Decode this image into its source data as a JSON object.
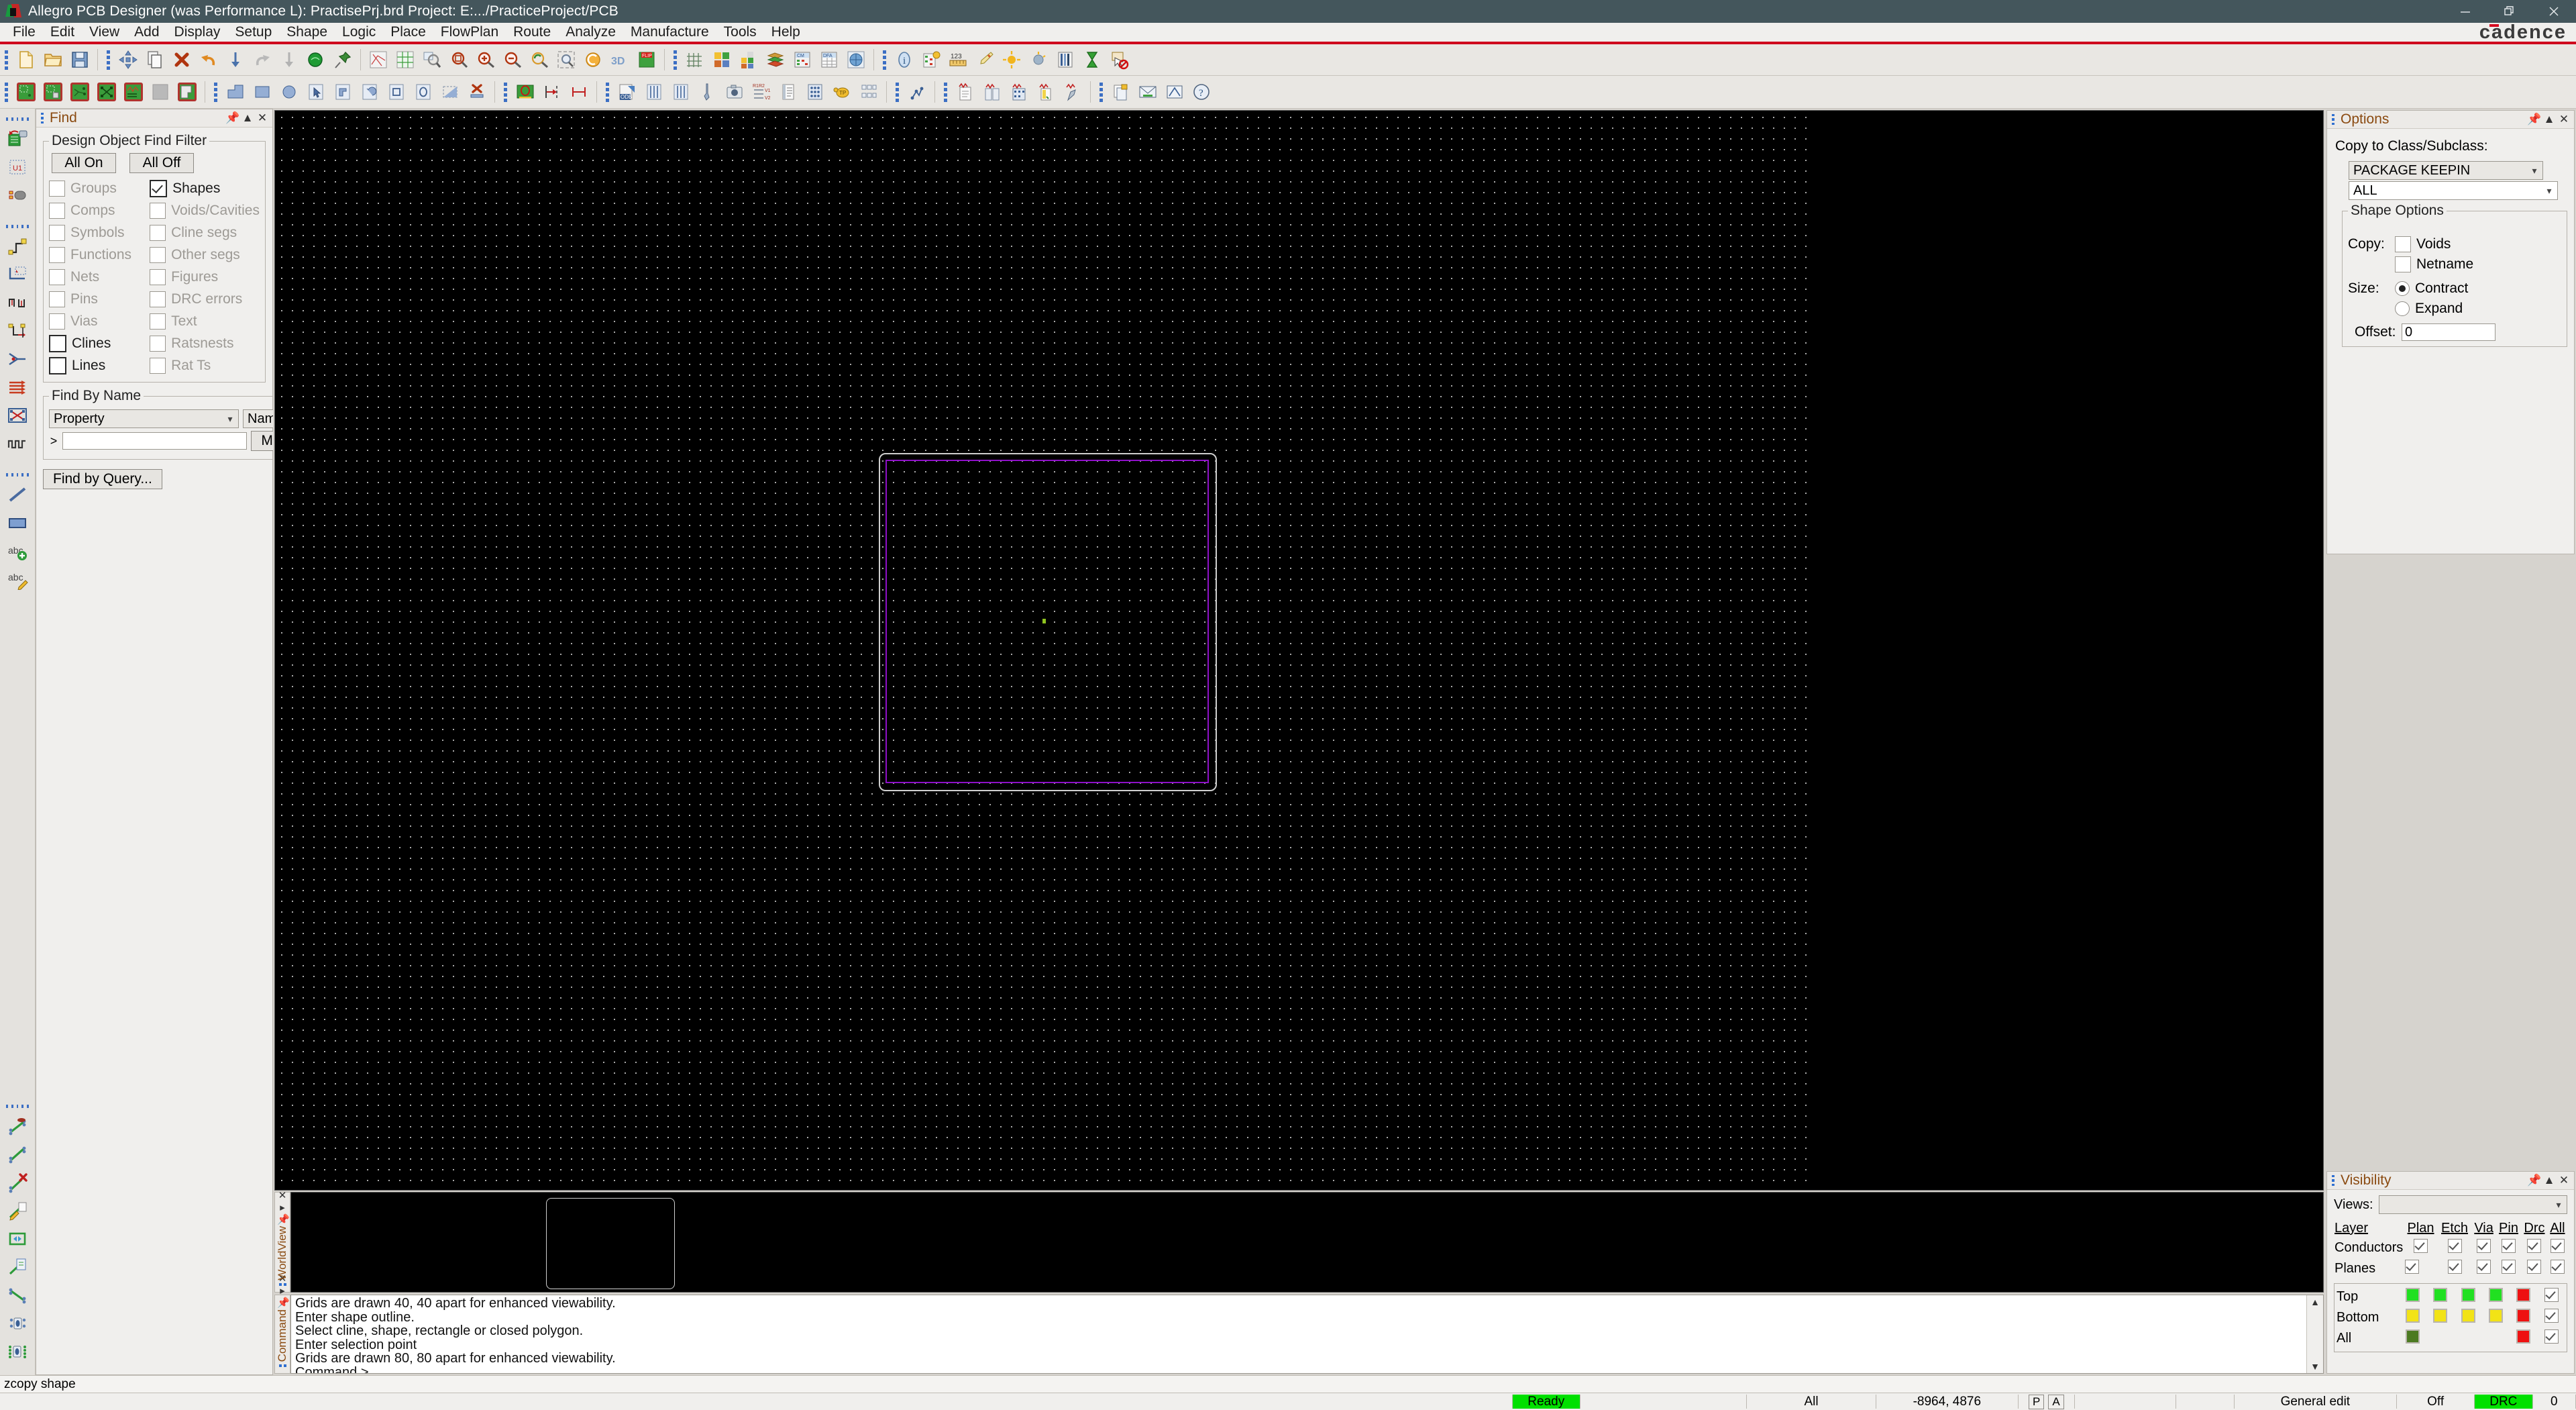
{
  "window": {
    "title": "Allegro PCB Designer (was Performance L): PractisePrj.brd  Project: E:.../PracticeProject/PCB",
    "app_icon": "allegro-icon",
    "minimize": "—",
    "restore": "restore-icon",
    "close": "✕",
    "brand": "cadence"
  },
  "menubar": {
    "items": [
      {
        "label": "File",
        "mnemonic": "F"
      },
      {
        "label": "Edit",
        "mnemonic": "E"
      },
      {
        "label": "View",
        "mnemonic": "V"
      },
      {
        "label": "Add",
        "mnemonic": "A"
      },
      {
        "label": "Display",
        "mnemonic": "D"
      },
      {
        "label": "Setup",
        "mnemonic": "u"
      },
      {
        "label": "Shape",
        "mnemonic": "S"
      },
      {
        "label": "Logic",
        "mnemonic": "L"
      },
      {
        "label": "Place",
        "mnemonic": "P"
      },
      {
        "label": "FlowPlan",
        "mnemonic": "n"
      },
      {
        "label": "Route",
        "mnemonic": "R"
      },
      {
        "label": "Analyze",
        "mnemonic": "z"
      },
      {
        "label": "Manufacture",
        "mnemonic": "M"
      },
      {
        "label": "Tools",
        "mnemonic": "T"
      },
      {
        "label": "Help",
        "mnemonic": "H"
      }
    ]
  },
  "toolbar_row1": {
    "icons": [
      "new-file-icon",
      "open-folder-icon",
      "save-icon",
      "move-icon",
      "copy-icon",
      "delete-icon",
      "undo-icon",
      "down-arrow-icon",
      "redo-icon",
      "down-arrow-grey-icon",
      "globe-green-icon",
      "pin-icon",
      "ratsnest-icon",
      "grid-net-icon",
      "zoom-fit-icon",
      "zoom-region-icon",
      "zoom-in-icon",
      "zoom-out-icon",
      "zoom-previous-icon",
      "zoom-selection-icon",
      "refresh-icon",
      "3d-view-icon",
      "flip-design-icon",
      "grid-toggle-icon",
      "color-palette-icon",
      "color-layers-icon",
      "layer-stackup-icon",
      "constraint-manager-icon",
      "dfa-table-icon",
      "globe-grid-icon",
      "info-icon",
      "property-edit-icon",
      "measure-icon",
      "highlight-icon",
      "sun-light-icon",
      "dim-icon",
      "layer-bars-icon",
      "hourglass-icon",
      "cursor-block-icon"
    ]
  },
  "toolbar_row2": {
    "icons": [
      "place-manual-icon",
      "place-quickplace-icon",
      "place-swap-icon",
      "place-autoplace-icon",
      "place-replicate-icon",
      "blank-shape-icon",
      "copy-shape-icon",
      "shape-polygon-icon",
      "shape-rect-icon",
      "shape-circle-icon",
      "shape-oval-icon",
      "shape-select-icon",
      "shape-rect2-icon",
      "shape-arc-icon",
      "shape-square-icon",
      "shape-ellipse-icon",
      "shape-void-icon",
      "shape-delete-icon",
      "board-geometry-icon",
      "dimension-line-icon",
      "dimension-measure-icon",
      "odb-export-icon",
      "drill-legend-icon",
      "nc-drill-icon",
      "drill-tool-icon",
      "camera-icon",
      "r1r2-rename-icon",
      "report-icon",
      "padstack-grid-icon",
      "testprep-icon",
      "bom-icon",
      "signal-probe-icon",
      "si-report-icon",
      "si-library-icon",
      "si-model-icon",
      "si-assign-icon",
      "si-sim-icon",
      "doc-export-icon",
      "mail-icon",
      "net-schedule-icon",
      "help-circle-icon"
    ]
  },
  "left_toolbar": {
    "groups": [
      {
        "icons": [
          "netlist-import-icon",
          "device-u1-icon",
          "pin-assign-icon"
        ]
      },
      {
        "icons": [
          "add-connect-icon",
          "route-area-icon",
          "phase-tune-icon",
          "delay-tune-icon",
          "fanout-icon",
          "bus-route-icon",
          "auto-route-icon",
          "meander-icon"
        ]
      },
      {
        "icons": [
          "line-icon",
          "rect-filled-icon",
          "add-text-icon",
          "edit-text-icon"
        ]
      }
    ],
    "bottom_group": {
      "icons": [
        "net-top-icon",
        "net-line-icon",
        "net-delete-icon",
        "net-edit-icon",
        "net-spread-icon",
        "net-copy-icon",
        "net-thin-icon",
        "net-via-icon",
        "net-multi-via-icon"
      ]
    }
  },
  "find_panel": {
    "title": "Find",
    "pin_icon": "pin-icon",
    "collapse_icon": "chevron-up-icon",
    "close_icon": "close-icon",
    "filter_group_label": "Design Object Find Filter",
    "all_on": "All On",
    "all_off": "All Off",
    "left_column": [
      {
        "label": "Groups",
        "checked": false,
        "enabled": false
      },
      {
        "label": "Comps",
        "checked": false,
        "enabled": false
      },
      {
        "label": "Symbols",
        "checked": false,
        "enabled": false
      },
      {
        "label": "Functions",
        "checked": false,
        "enabled": false
      },
      {
        "label": "Nets",
        "checked": false,
        "enabled": false
      },
      {
        "label": "Pins",
        "checked": false,
        "enabled": false
      },
      {
        "label": "Vias",
        "checked": false,
        "enabled": false
      },
      {
        "label": "Clines",
        "checked": false,
        "enabled": true
      },
      {
        "label": "Lines",
        "checked": false,
        "enabled": true
      }
    ],
    "right_column": [
      {
        "label": "Shapes",
        "checked": true,
        "enabled": true
      },
      {
        "label": "Voids/Cavities",
        "checked": false,
        "enabled": false
      },
      {
        "label": "Cline segs",
        "checked": false,
        "enabled": false
      },
      {
        "label": "Other segs",
        "checked": false,
        "enabled": false
      },
      {
        "label": "Figures",
        "checked": false,
        "enabled": false
      },
      {
        "label": "DRC errors",
        "checked": false,
        "enabled": false
      },
      {
        "label": "Text",
        "checked": false,
        "enabled": false
      },
      {
        "label": "Ratsnests",
        "checked": false,
        "enabled": false
      },
      {
        "label": "Rat Ts",
        "checked": false,
        "enabled": false
      }
    ],
    "find_by_name_label": "Find By Name",
    "type_select": "Property",
    "scope_select": "Name",
    "name_value": "",
    "more_button": "More...",
    "find_by_query": "Find by Query..."
  },
  "options_panel": {
    "title": "Options",
    "copy_to_label": "Copy to Class/Subclass:",
    "class_select": "PACKAGE KEEPIN",
    "subclass_select": "ALL",
    "shape_options_label": "Shape Options",
    "copy_label": "Copy:",
    "voids": {
      "label": "Voids",
      "checked": false
    },
    "netname": {
      "label": "Netname",
      "checked": false
    },
    "size_label": "Size:",
    "contract": {
      "label": "Contract",
      "selected": true
    },
    "expand": {
      "label": "Expand",
      "selected": false
    },
    "offset_label": "Offset:",
    "offset_value": "0"
  },
  "visibility_panel": {
    "title": "Visibility",
    "views_label": "Views:",
    "views_value": "",
    "headers": [
      "Layer",
      "Plan",
      "Etch",
      "Via",
      "Pin",
      "Drc",
      "All"
    ],
    "rows": [
      {
        "label": "Conductors",
        "cells": [
          "",
          "check",
          "check",
          "check",
          "check",
          "check",
          "check"
        ]
      },
      {
        "label": "Planes",
        "cells": [
          "check",
          "",
          "check",
          "check",
          "check",
          "check",
          "check"
        ]
      }
    ],
    "layer_rows": [
      {
        "label": "Top",
        "cells": [
          "#21e021",
          "#21e021",
          "#21e021",
          "#21e021",
          "#ee1111",
          "check"
        ]
      },
      {
        "label": "Bottom",
        "cells": [
          "#f2e316",
          "#f2e316",
          "#f2e316",
          "#f2e316",
          "#ee1111",
          "check"
        ]
      },
      {
        "label": "All",
        "cells": [
          "#4c7a21",
          "",
          "",
          "",
          "#ee1111",
          "check"
        ]
      }
    ]
  },
  "worldview": {
    "title": "WorldView",
    "close_icon": "close-icon",
    "expand_icon": "chevron-right-icon",
    "pin_icon": "pin-icon"
  },
  "console": {
    "title": "Command",
    "close_icon": "close-icon",
    "expand_icon": "chevron-right-icon",
    "pin_icon": "pin-icon",
    "lines": [
      "Grids are drawn 40, 40 apart for enhanced viewability.",
      "Enter shape outline.",
      "Select cline, shape, rectangle or closed polygon.",
      "Enter selection point",
      "Grids are drawn 80, 80 apart for enhanced viewability.",
      "Command >"
    ],
    "scroll_up": "▲",
    "scroll_down": "▼"
  },
  "statusbar": {
    "message": "zcopy shape",
    "ready": "Ready",
    "scope": "All",
    "coords": "-8964, 4876",
    "pick_mode": "P",
    "align_mode": "A",
    "mode": "General edit",
    "snap": "Off",
    "drc": "DRC",
    "drc_count": "0"
  },
  "colors": {
    "title_bar": "#44565c",
    "accent_red": "#cf0a1e",
    "panel_title": "#8a4a10",
    "canvas_bg": "#000000",
    "board_outline": "#cfcfcf",
    "shape_outline": "#8e10c8",
    "status_green": "#00e000"
  }
}
